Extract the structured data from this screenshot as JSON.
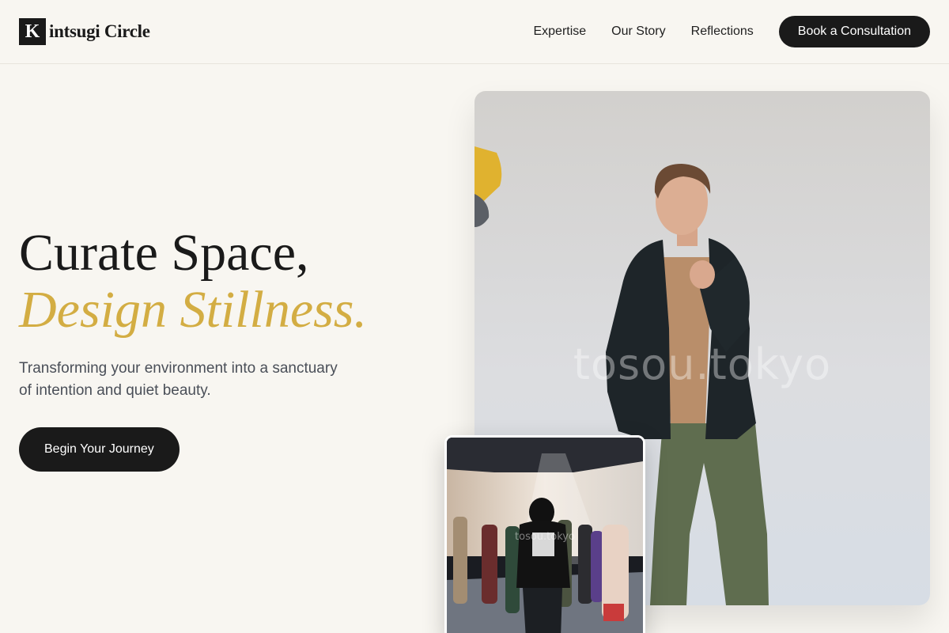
{
  "header": {
    "logo_letter": "K",
    "logo_text": "intsugi Circle",
    "nav": {
      "expertise": "Expertise",
      "our_story": "Our Story",
      "reflections": "Reflections"
    },
    "cta_label": "Book a Consultation"
  },
  "hero": {
    "title_line1": "Curate Space,",
    "title_line2": "Design Stillness.",
    "subtitle": "Transforming your environment into a sanctuary of intention and quiet beauty.",
    "button_label": "Begin Your Journey"
  },
  "images": {
    "main_watermark": "tosou.tokyo",
    "inset_watermark": "tosou.tokyo"
  },
  "colors": {
    "background": "#f8f6f1",
    "text_dark": "#1a1a1a",
    "accent_gold": "#d3ad43",
    "subtitle_gray": "#4a4f58",
    "button_dark": "#1a1a1a"
  }
}
